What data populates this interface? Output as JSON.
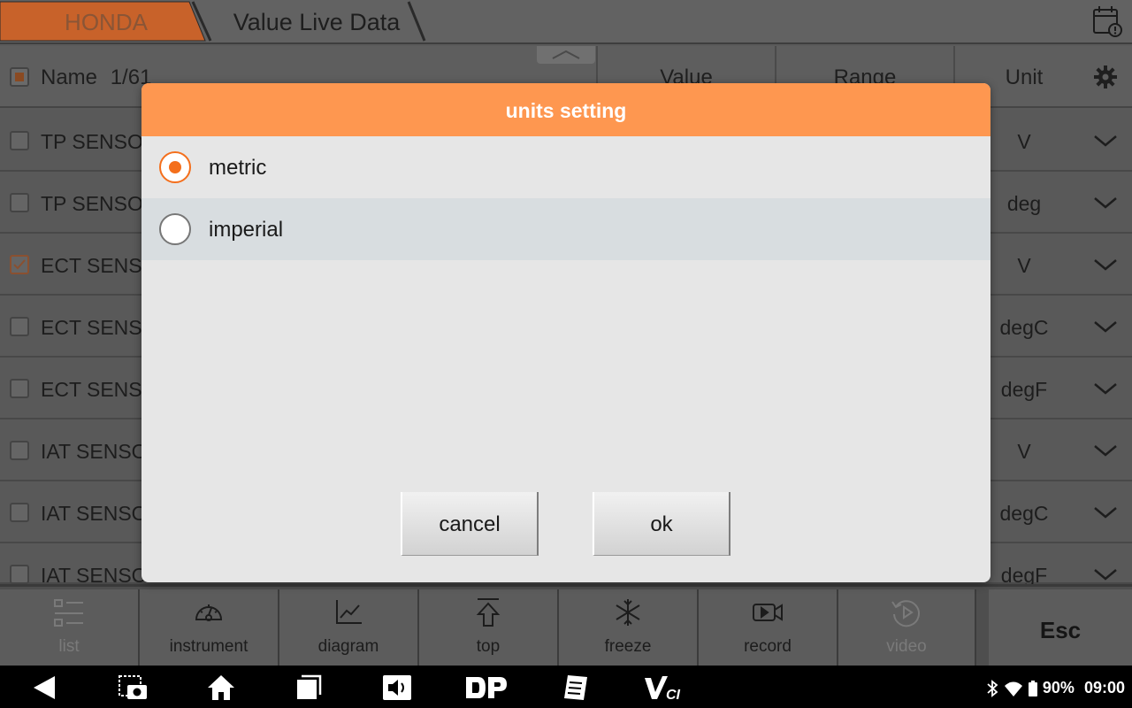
{
  "header": {
    "brand": "HONDA",
    "page_title": "Value Live Data",
    "calendar_icon": "calendar-alert-icon"
  },
  "colors": {
    "accent": "#fe9750",
    "radio_selected": "#f46f1c",
    "brand_tab": "#d46a28"
  },
  "table": {
    "columns": {
      "name": "Name",
      "count": "1/61",
      "value": "Value",
      "range": "Range",
      "unit": "Unit"
    },
    "rows": [
      {
        "name": "TP SENSOR",
        "unit": "V",
        "checked": false
      },
      {
        "name": "TP SENSOR",
        "unit": "deg",
        "checked": false
      },
      {
        "name": "ECT SENSOR",
        "unit": "V",
        "checked": true
      },
      {
        "name": "ECT SENSOR",
        "unit": "degC",
        "checked": false
      },
      {
        "name": "ECT SENSOR",
        "unit": "degF",
        "checked": false
      },
      {
        "name": "IAT SENSOR",
        "unit": "V",
        "checked": false
      },
      {
        "name": "IAT SENSOR",
        "unit": "degC",
        "checked": false
      },
      {
        "name": "IAT SENSOR",
        "unit": "degF",
        "checked": false
      }
    ]
  },
  "toolbar": {
    "list": "list",
    "instrument": "instrument",
    "diagram": "diagram",
    "top": "top",
    "freeze": "freeze",
    "record": "record",
    "video": "video",
    "esc": "Esc"
  },
  "dialog": {
    "title": "units setting",
    "options": [
      {
        "label": "metric",
        "selected": true
      },
      {
        "label": "imperial",
        "selected": false
      }
    ],
    "cancel": "cancel",
    "ok": "ok"
  },
  "statusbar": {
    "battery": "90%",
    "time": "09:00"
  }
}
